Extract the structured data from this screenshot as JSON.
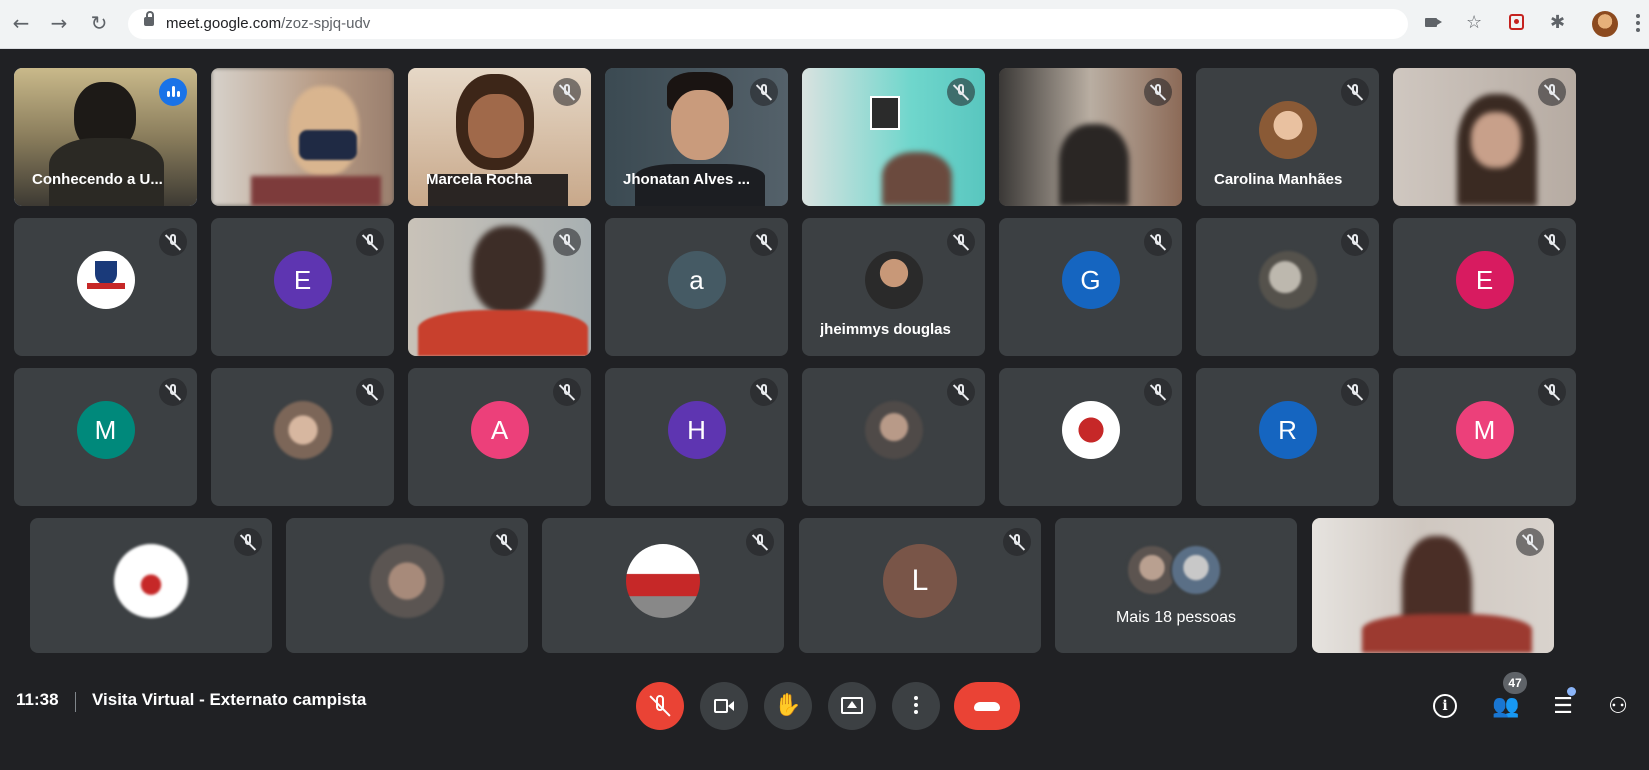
{
  "browser": {
    "url_host": "meet.google.com",
    "url_path": "/zoz-spjq-udv"
  },
  "grid": {
    "row1": [
      {
        "name": "Conhecendo a U...",
        "speaking": true
      },
      {
        "name": ""
      },
      {
        "name": "Marcela Rocha"
      },
      {
        "name": "Jhonatan Alves ..."
      },
      {
        "name": ""
      },
      {
        "name": ""
      },
      {
        "name": "Carolina Manhães",
        "avatar": "photo"
      },
      {
        "name": ""
      }
    ],
    "row2": [
      {
        "name": "",
        "avatar": "logo"
      },
      {
        "name": "",
        "avatar": "E",
        "color": "#5e35b1"
      },
      {
        "name": ""
      },
      {
        "name": "",
        "avatar": "a",
        "color": "#455a64"
      },
      {
        "name": "jheimmys douglas",
        "avatar": "photo"
      },
      {
        "name": "",
        "avatar": "G",
        "color": "#1565c0"
      },
      {
        "name": "",
        "avatar": "photo"
      },
      {
        "name": "",
        "avatar": "E",
        "color": "#d81b60"
      }
    ],
    "row3": [
      {
        "name": "",
        "avatar": "M",
        "color": "#00897b"
      },
      {
        "name": "",
        "avatar": "photo"
      },
      {
        "name": "",
        "avatar": "A",
        "color": "#ec407a"
      },
      {
        "name": "",
        "avatar": "H",
        "color": "#5e35b1"
      },
      {
        "name": "",
        "avatar": "photo"
      },
      {
        "name": "",
        "avatar": "photo"
      },
      {
        "name": "",
        "avatar": "R",
        "color": "#1565c0"
      },
      {
        "name": "",
        "avatar": "M",
        "color": "#ec407a"
      }
    ],
    "row4": [
      {
        "name": "",
        "avatar": "photo"
      },
      {
        "name": "",
        "avatar": "photo"
      },
      {
        "name": "",
        "avatar": "photo"
      },
      {
        "name": "",
        "avatar": "L",
        "color": "#795548"
      },
      {
        "more_label": "Mais 18 pessoas"
      },
      {
        "name": ""
      }
    ]
  },
  "bottom_bar": {
    "time": "11:38",
    "meeting_title": "Visita Virtual - Externato campista",
    "participant_count": "47"
  },
  "colors": {
    "background": "#202124",
    "tile": "#3c4043",
    "accent_red": "#ea4335",
    "accent_blue": "#1a73e8"
  }
}
